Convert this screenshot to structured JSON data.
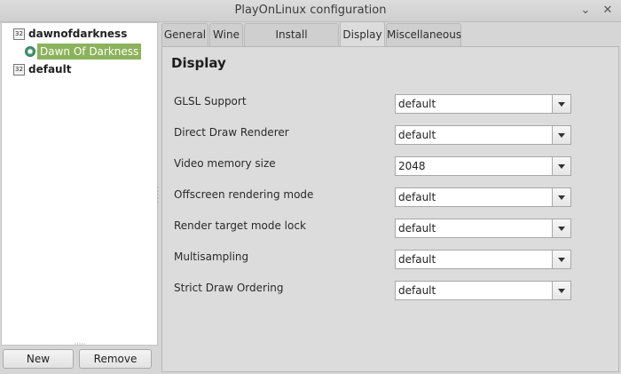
{
  "window": {
    "title": "PlayOnLinux configuration",
    "minimize_glyph": "⌄",
    "close_glyph": "✕"
  },
  "tree": {
    "items": [
      {
        "label": "dawnofdarkness",
        "badge": "32",
        "bold": true
      },
      {
        "label": "Dawn Of Darkness",
        "selected": true,
        "icon": "wine-gear-icon"
      },
      {
        "label": "default",
        "badge": "32",
        "bold": true
      }
    ]
  },
  "buttons": {
    "new": "New",
    "remove": "Remove"
  },
  "tabs": [
    {
      "label": "General"
    },
    {
      "label": "Wine"
    },
    {
      "label": "Install components"
    },
    {
      "label": "Display",
      "active": true
    },
    {
      "label": "Miscellaneous"
    }
  ],
  "display": {
    "heading": "Display",
    "settings": [
      {
        "label": "GLSL Support",
        "value": "default"
      },
      {
        "label": "Direct Draw Renderer",
        "value": "default"
      },
      {
        "label": "Video memory size",
        "value": "2048"
      },
      {
        "label": "Offscreen rendering mode",
        "value": "default"
      },
      {
        "label": "Render target mode lock",
        "value": "default"
      },
      {
        "label": "Multisampling",
        "value": "default"
      },
      {
        "label": "Strict Draw Ordering",
        "value": "default"
      }
    ]
  },
  "colors": {
    "selection": "#8cb35b",
    "panel": "#dcdcdc"
  }
}
